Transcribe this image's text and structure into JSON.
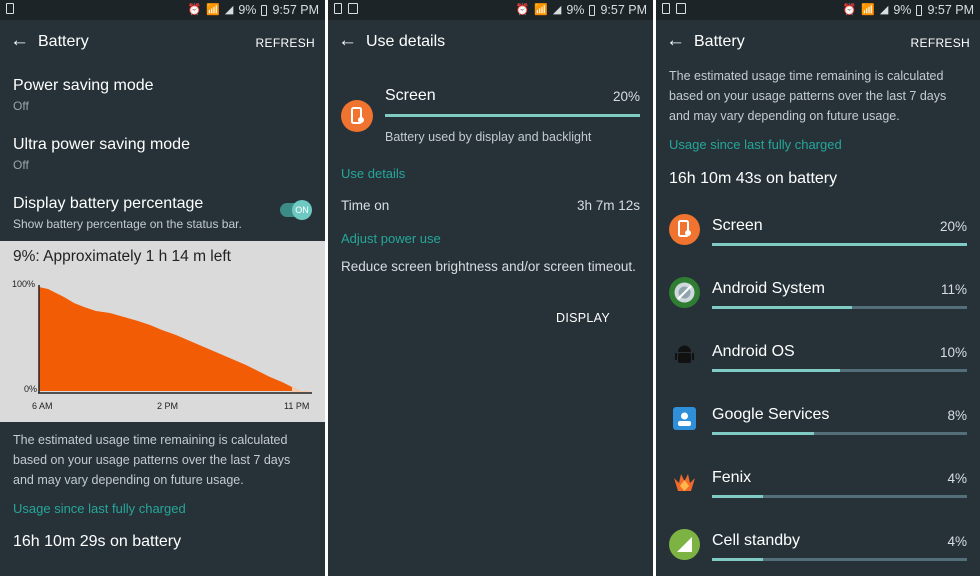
{
  "status_bar": {
    "battery": "9%",
    "time": "9:57 PM"
  },
  "panel1": {
    "title": "Battery",
    "action": "REFRESH",
    "settings": [
      {
        "title": "Power saving mode",
        "sub": "Off"
      },
      {
        "title": "Ultra power saving mode",
        "sub": "Off"
      },
      {
        "title": "Display battery percentage",
        "sub": "Show battery percentage on the status bar."
      }
    ],
    "toggle_label": "ON",
    "graph": {
      "headline": "9%: Approximately 1 h 14 m left",
      "y_top": "100%",
      "y_bottom": "0%",
      "x_labels": [
        "6 AM",
        "2 PM",
        "11 PM"
      ]
    },
    "description": "The estimated usage time remaining is calculated based on your usage patterns over the last 7 days and may vary depending on future usage.",
    "usage_since": "Usage since last fully charged",
    "on_battery": "16h 10m 29s on battery"
  },
  "panel2": {
    "title": "Use details",
    "app_name": "Screen",
    "app_pct": "20%",
    "app_pct_value": 20,
    "app_desc": "Battery used by display and backlight",
    "section_use": "Use details",
    "time_on_label": "Time on",
    "time_on_value": "3h 7m 12s",
    "section_adjust": "Adjust power use",
    "adjust_text": "Reduce screen brightness and/or screen timeout.",
    "display_button": "DISPLAY"
  },
  "panel3": {
    "title": "Battery",
    "action": "REFRESH",
    "description": "The estimated usage time remaining is calculated based on your usage patterns over the last 7 days and may vary depending on future usage.",
    "usage_since": "Usage since last fully charged",
    "on_battery": "16h 10m 43s on battery",
    "items": [
      {
        "name": "Screen",
        "pct": "20%",
        "value": 20,
        "icon": "screen-icon",
        "color": "#f0732f"
      },
      {
        "name": "Android System",
        "pct": "11%",
        "value": 11,
        "icon": "android-system-icon",
        "color": "#2e7d32"
      },
      {
        "name": "Android OS",
        "pct": "10%",
        "value": 10,
        "icon": "android-os-icon",
        "color": "#111111"
      },
      {
        "name": "Google Services",
        "pct": "8%",
        "value": 8,
        "icon": "google-services-icon",
        "color": "#2f8fd8"
      },
      {
        "name": "Fenix",
        "pct": "4%",
        "value": 4,
        "icon": "fenix-icon",
        "color": "#f26a2a"
      },
      {
        "name": "Cell standby",
        "pct": "4%",
        "value": 4,
        "icon": "cell-standby-icon",
        "color": "#7cb342"
      }
    ]
  },
  "colors": {
    "accent": "#26a69a",
    "graph_fill": "#f25c05",
    "panel_bg": "#263238"
  }
}
